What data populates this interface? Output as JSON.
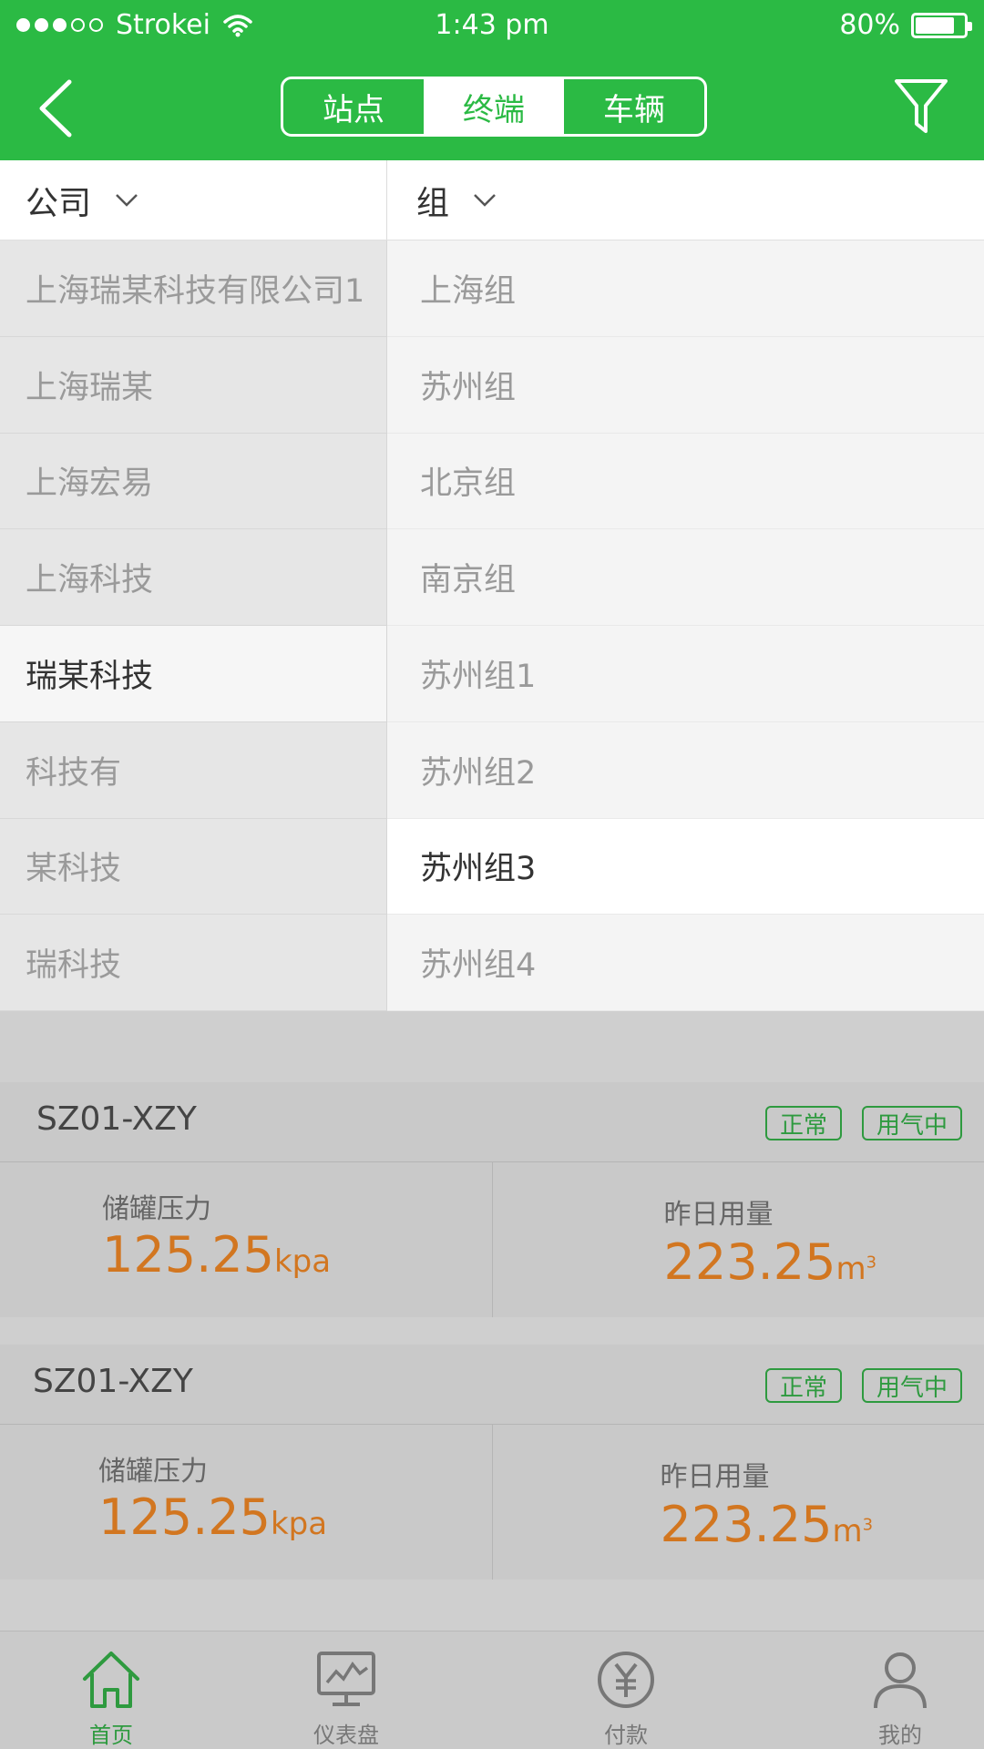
{
  "status": {
    "carrier": "Strokei",
    "time": "1:43 pm",
    "battery": "80%",
    "battery_level": 0.8,
    "signal_bars": 3
  },
  "header": {
    "tabs": [
      {
        "label": "站点",
        "active": false
      },
      {
        "label": "终端",
        "active": true
      },
      {
        "label": "车辆",
        "active": false
      }
    ],
    "icons": {
      "back": "back-chevron-icon",
      "filter": "filter-funnel-icon"
    }
  },
  "filter": {
    "company_label": "公司",
    "group_label": "组",
    "companies": [
      "上海瑞某科技有限公司1",
      "上海瑞某",
      "上海宏易",
      "上海科技",
      "瑞某科技",
      "科技有",
      "某科技",
      "瑞科技"
    ],
    "selected_company_index": 4,
    "groups": [
      "上海组",
      "苏州组",
      "北京组",
      "南京组",
      "苏州组1",
      "苏州组2",
      "苏州组3",
      "苏州组4"
    ],
    "selected_group_index": 6
  },
  "cards": [
    {
      "title": "SZ01-XZY",
      "badges": [
        "正常",
        "用气中"
      ],
      "pressure_label": "储罐压力",
      "pressure_value": "125.25",
      "pressure_unit": "kpa",
      "usage_label": "昨日用量",
      "usage_value": "223.25",
      "usage_unit": "m",
      "usage_unit_sup": "3"
    },
    {
      "title": "SZ01-XZY",
      "badges": [
        "正常",
        "用气中"
      ],
      "pressure_label": "储罐压力",
      "pressure_value": "125.25",
      "pressure_unit": "kpa",
      "usage_label": "昨日用量",
      "usage_value": "223.25",
      "usage_unit": "m",
      "usage_unit_sup": "3"
    }
  ],
  "tabbar": [
    {
      "label": "首页",
      "icon": "home-icon",
      "active": true
    },
    {
      "label": "仪表盘",
      "icon": "dashboard-monitor-icon",
      "active": false
    },
    {
      "label": "付款",
      "icon": "yuan-coin-icon",
      "active": false
    },
    {
      "label": "我的",
      "icon": "user-icon",
      "active": false
    }
  ],
  "colors": {
    "brand_green": "#2bba44",
    "badge_green": "#2e9a3f",
    "value_orange": "#d27620"
  }
}
